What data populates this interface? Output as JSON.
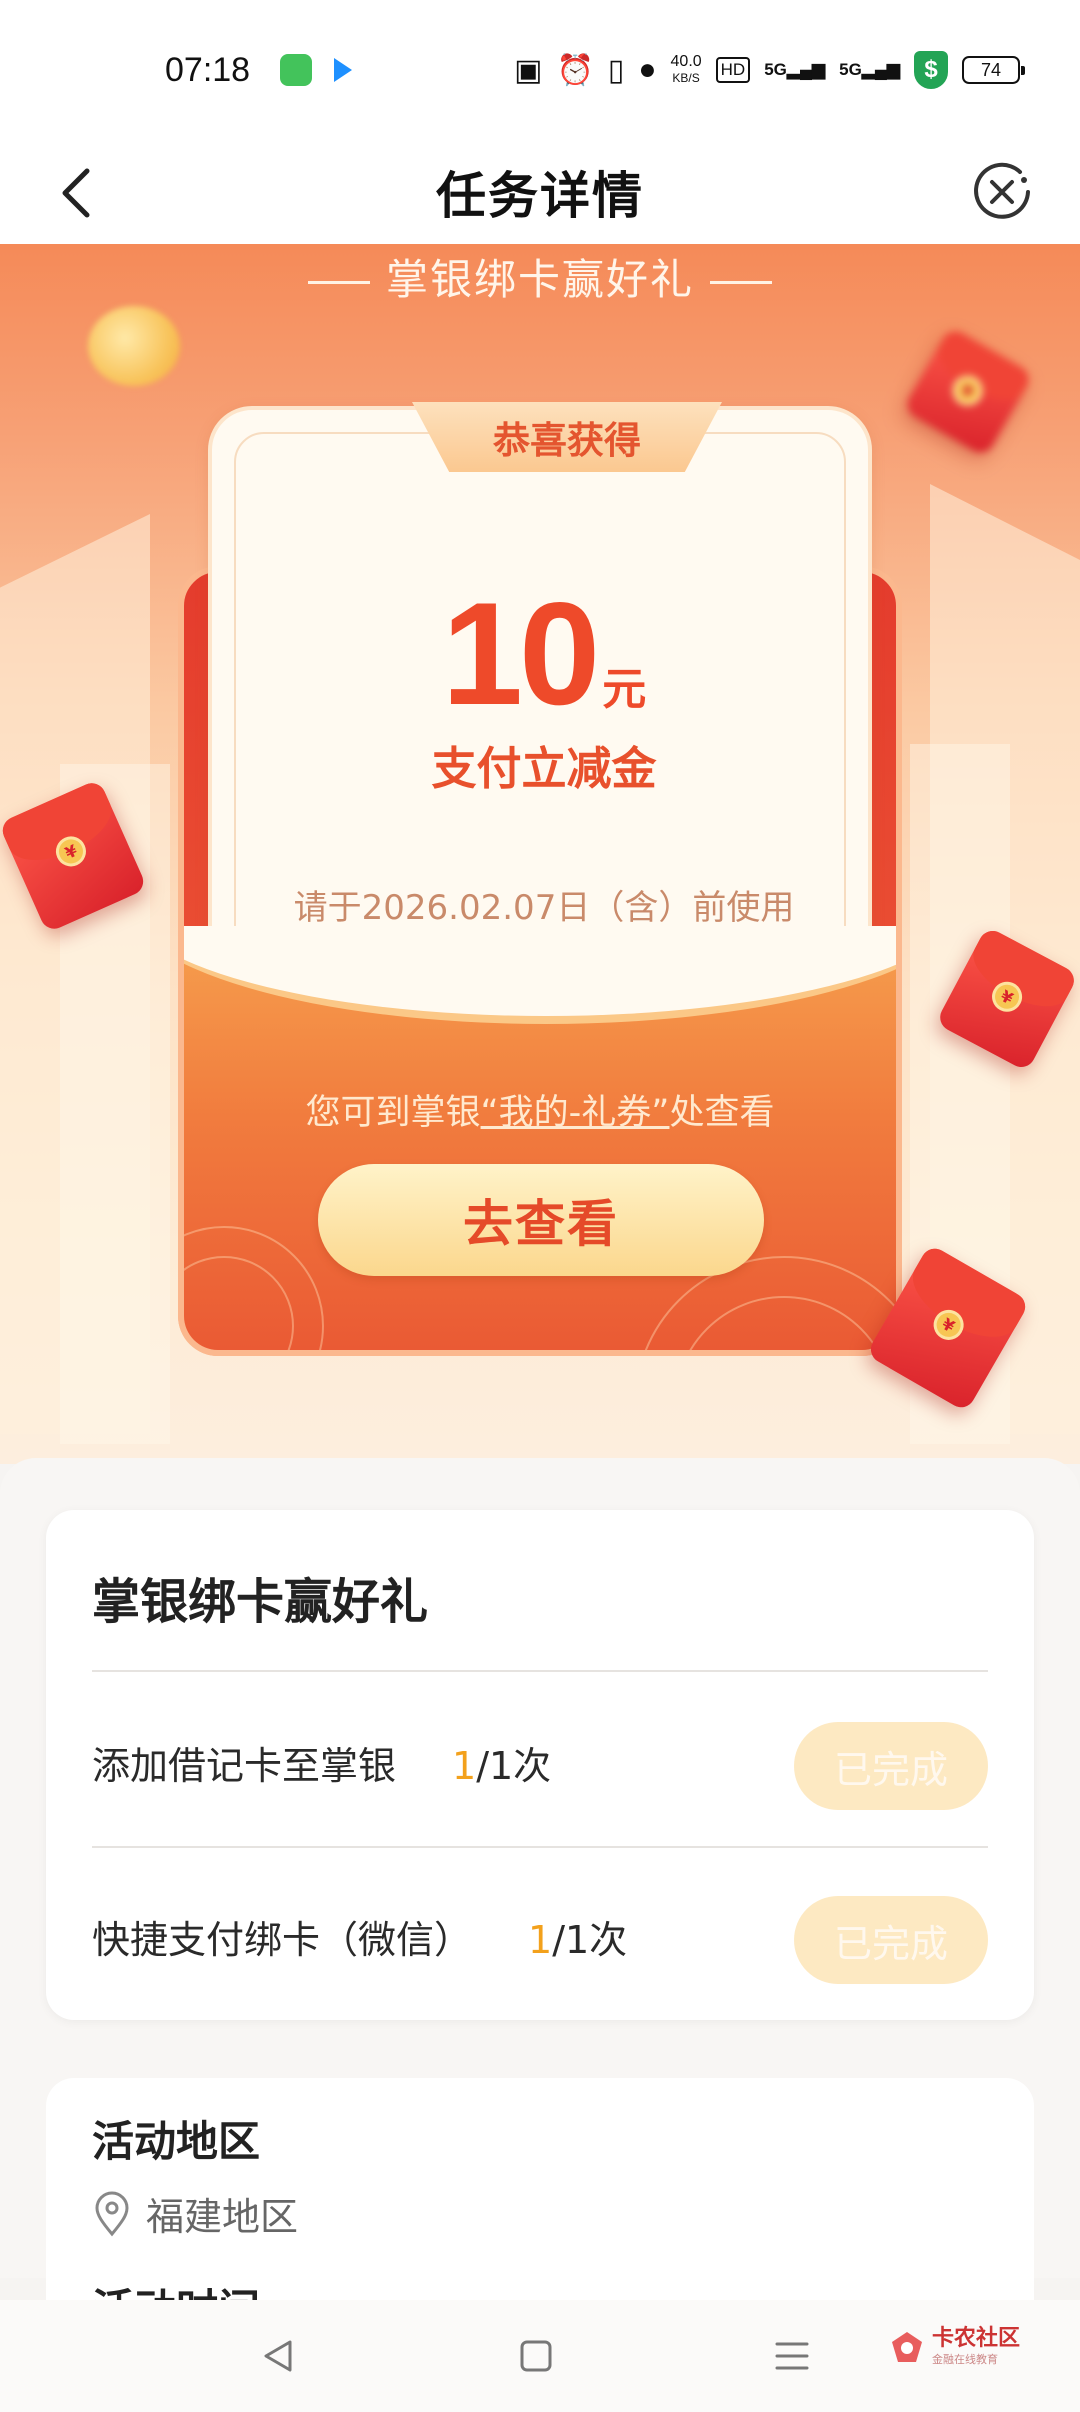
{
  "status_bar": {
    "time": "07:18",
    "net_speed_value": "40.0",
    "net_speed_unit": "KB/S",
    "hd_label": "HD",
    "signal1_label": "5G",
    "signal2_label": "5G",
    "shield_symbol": "$",
    "battery": "74",
    "icons": [
      "message-app-icon",
      "arrow-app-icon",
      "nfc-icon",
      "alarm-icon",
      "vibrate-icon",
      "location-icon",
      "hd-icon",
      "signal-icon",
      "signal-icon",
      "shield-icon",
      "battery-icon"
    ]
  },
  "nav": {
    "title": "任务详情",
    "back_icon": "chevron-left-icon",
    "close_icon": "close-circle-icon"
  },
  "banner": {
    "title": "掌银绑卡赢好礼",
    "ribbon": "恭喜获得",
    "amount": "10",
    "unit": "元",
    "subtitle": "支付立减金",
    "validity": "请于2026.02.07日（含）前使用",
    "hint_prefix": "您可到掌银",
    "hint_link": "“我的-礼券”",
    "hint_suffix": "处查看",
    "cta": "去查看",
    "colors": {
      "accent": "#ee4a2a",
      "button": "#fbd78d"
    }
  },
  "task_card": {
    "title": "掌银绑卡赢好礼",
    "tasks": [
      {
        "label": "添加借记卡至掌银",
        "done": "1",
        "total": "/1次",
        "status": "已完成"
      },
      {
        "label": "快捷支付绑卡（微信）",
        "done": "1",
        "total": "/1次",
        "status": "已完成"
      }
    ]
  },
  "info": {
    "region_title": "活动地区",
    "region_value": "福建地区",
    "time_title": "活动时间"
  },
  "watermark": {
    "name": "卡农社区",
    "slogan": "金融在线教育"
  }
}
